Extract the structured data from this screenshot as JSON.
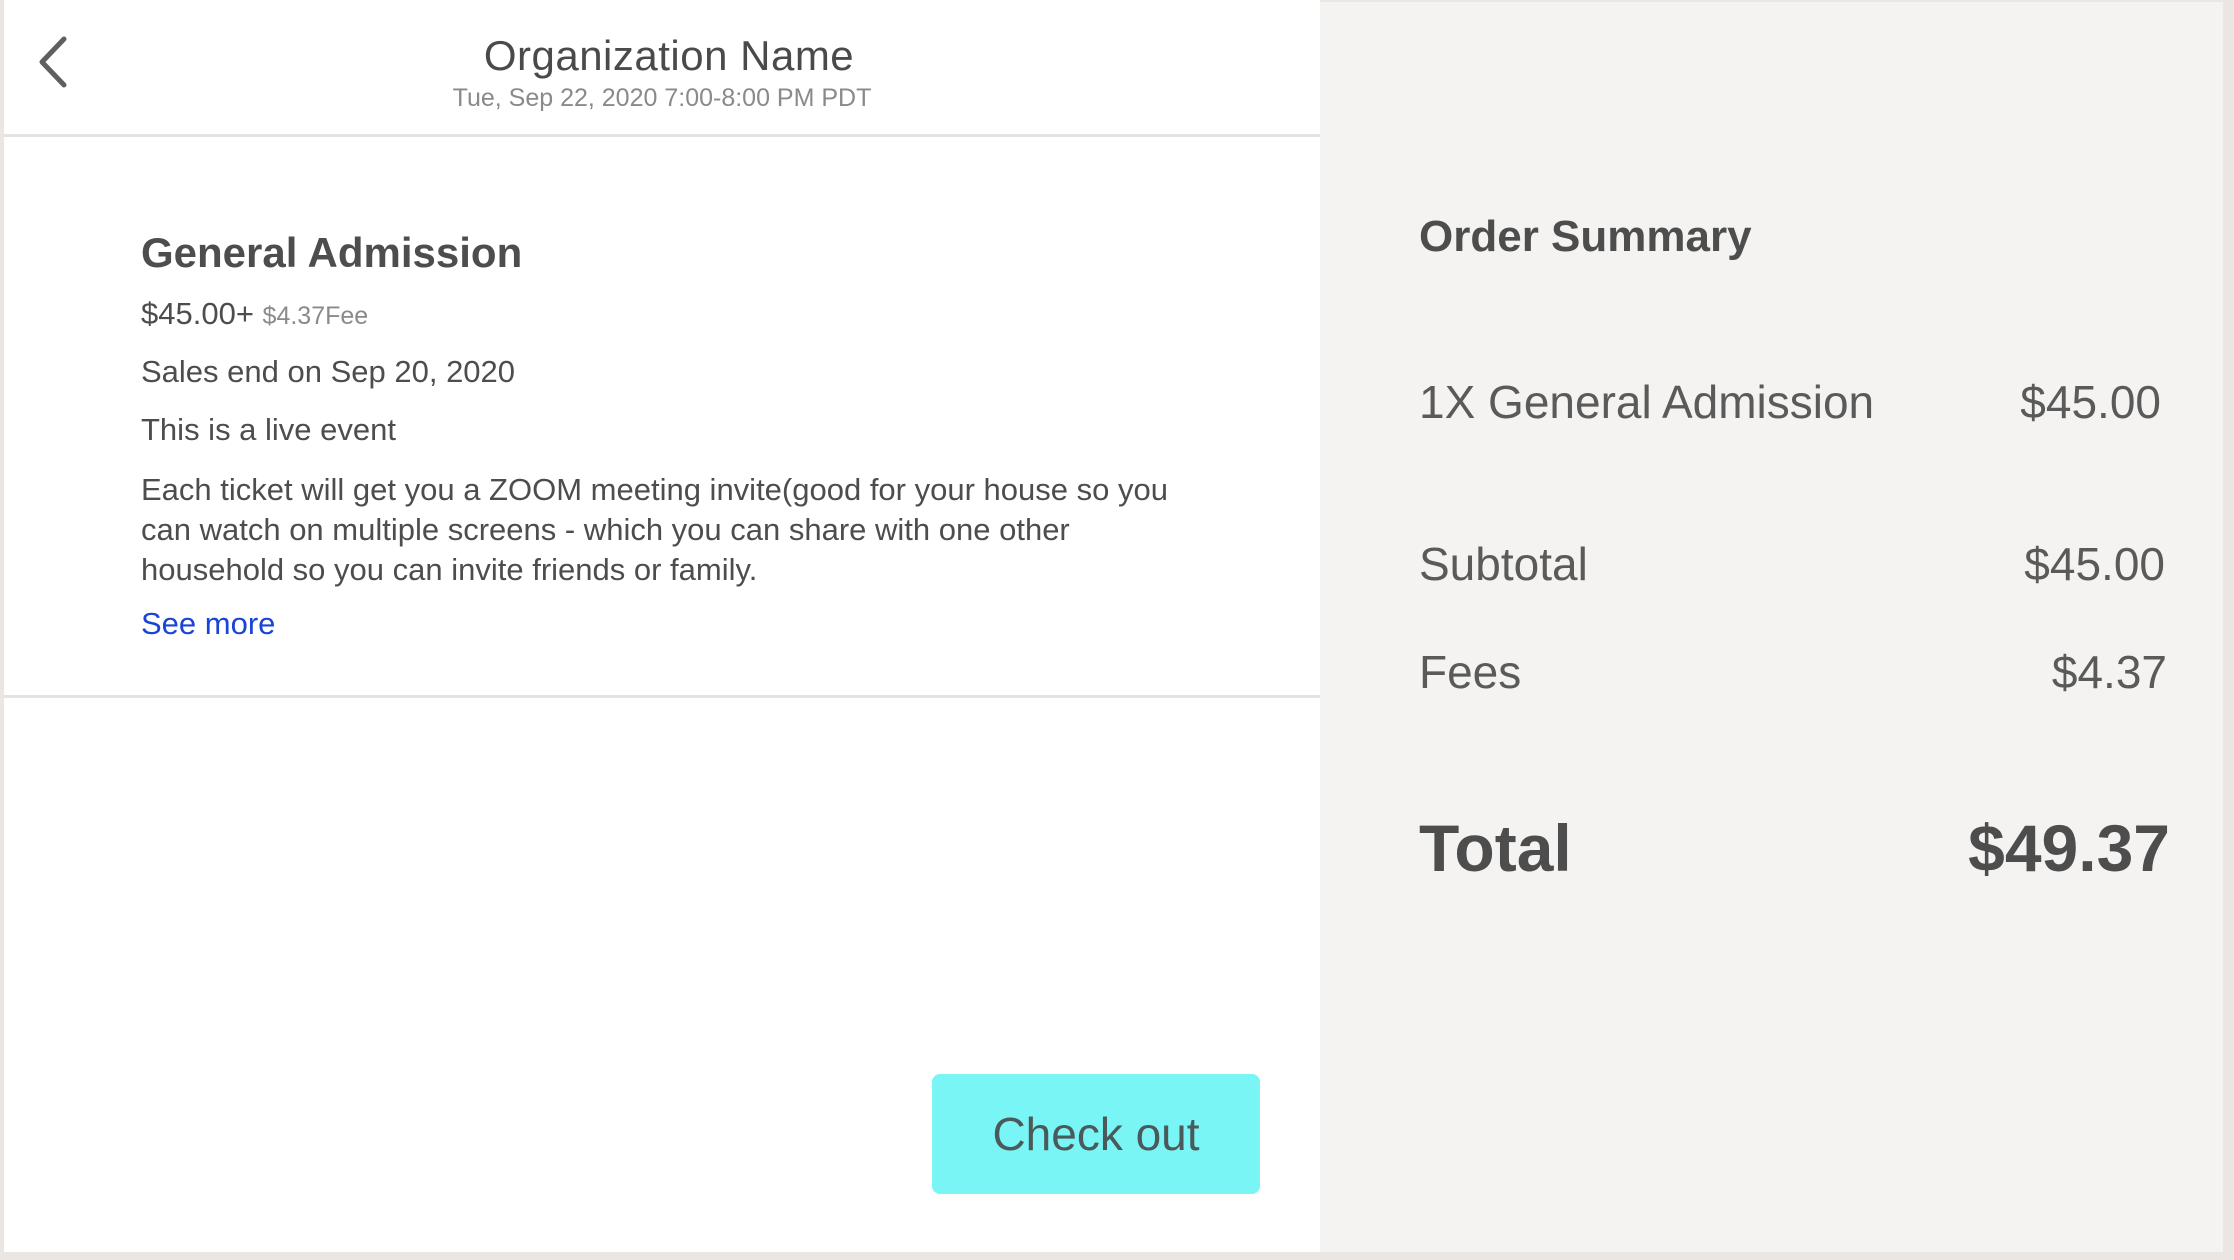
{
  "header": {
    "org_name": "Organization Name",
    "event_date": "Tue, Sep 22, 2020 7:00-8:00 PM PDT",
    "back_icon": "chevron-left-icon"
  },
  "ticket": {
    "title": "General Admission",
    "price": "$45.00+",
    "fee": "$4.37Fee",
    "sales_end": "Sales end on Sep 20, 2020",
    "live_event": "This is a live event",
    "description": "Each ticket will get you a ZOOM meeting invite(good for your house so you can watch on multiple screens - which you can share with one other household  so you can invite friends or family.",
    "see_more": "See more",
    "link_color": "#1a44d6"
  },
  "checkout": {
    "label": "Check out",
    "color": "#7af5f5"
  },
  "summary": {
    "title": "Order Summary",
    "line_item_label": "1X General Admission",
    "line_item_value": "$45.00",
    "subtotal_label": "Subtotal",
    "subtotal_value": "$45.00",
    "fees_label": "Fees",
    "fees_value": "$4.37",
    "total_label": "Total",
    "total_value": "$49.37"
  }
}
